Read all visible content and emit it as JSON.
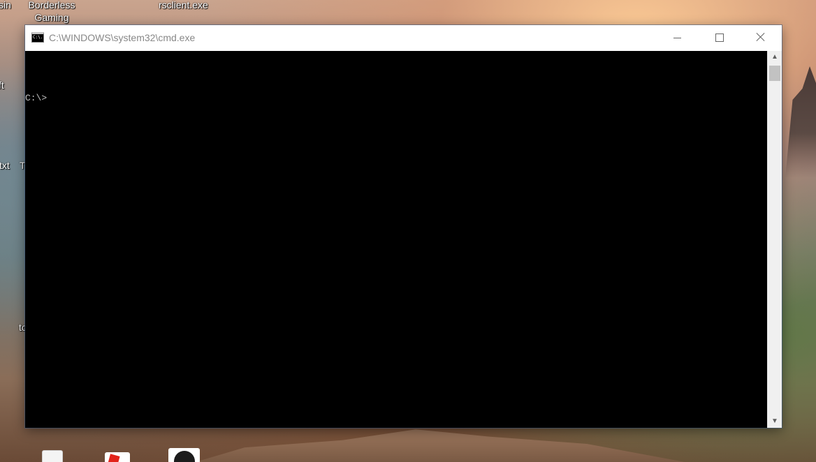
{
  "desktop": {
    "labels": [
      {
        "id": "label-sin",
        "text": "sin"
      },
      {
        "id": "label-borderless-gaming",
        "text": "Borderless\nGaming"
      },
      {
        "id": "label-rsclient",
        "text": "rsclient.exe"
      },
      {
        "id": "label-ft",
        "text": "ft"
      },
      {
        "id": "label-txt",
        "text": "txt"
      },
      {
        "id": "label-t",
        "text": "T"
      },
      {
        "id": "label-tc",
        "text": "tc"
      }
    ],
    "label_borderless_line1": "Borderless",
    "label_borderless_line2": "Gaming"
  },
  "window": {
    "title": "C:\\WINDOWS\\system32\\cmd.exe",
    "icon": "console-icon",
    "icon_glyph": "C:\\.",
    "minimize_icon": "minimize-icon",
    "maximize_icon": "maximize-icon",
    "close_icon": "close-icon"
  },
  "console": {
    "prompt": "C:\\>"
  },
  "scrollbar": {
    "up_glyph": "▲",
    "down_glyph": "▼"
  }
}
